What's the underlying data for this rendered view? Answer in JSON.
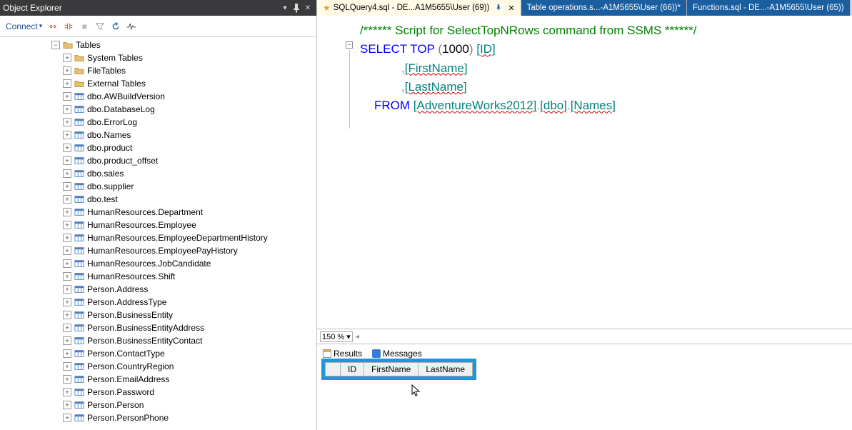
{
  "panel": {
    "title": "Object Explorer",
    "connect_label": "Connect"
  },
  "tree": {
    "root": "Tables",
    "system_tables": "System Tables",
    "file_tables": "FileTables",
    "external_tables": "External Tables",
    "items": [
      "dbo.AWBuildVersion",
      "dbo.DatabaseLog",
      "dbo.ErrorLog",
      "dbo.Names",
      "dbo.product",
      "dbo.product_offset",
      "dbo.sales",
      "dbo.supplier",
      "dbo.test",
      "HumanResources.Department",
      "HumanResources.Employee",
      "HumanResources.EmployeeDepartmentHistory",
      "HumanResources.EmployeePayHistory",
      "HumanResources.JobCandidate",
      "HumanResources.Shift",
      "Person.Address",
      "Person.AddressType",
      "Person.BusinessEntity",
      "Person.BusinessEntityAddress",
      "Person.BusinessEntityContact",
      "Person.ContactType",
      "Person.CountryRegion",
      "Person.EmailAddress",
      "Person.Password",
      "Person.Person",
      "Person.PersonPhone"
    ]
  },
  "tabs": [
    {
      "label": "SQLQuery4.sql - DE...A1M5655\\User (69))",
      "active": true,
      "pinned": true
    },
    {
      "label": "Table operations.s...-A1M5655\\User (66))*",
      "active": false
    },
    {
      "label": "Functions.sql - DE...-A1M5655\\User (65))",
      "active": false
    }
  ],
  "sql": {
    "comment": "/****** Script for SelectTopNRows command from SSMS  ******/",
    "select": "SELECT",
    "top": "TOP",
    "lparen": "(",
    "num": "1000",
    "rparen": ")",
    "col1": "[ID]",
    "col2": "[FirstName]",
    "col3": "[LastName]",
    "from": "FROM",
    "db": "[AdventureWorks2012]",
    "schema": "[dbo]",
    "table": "[Names]",
    "dot": ".",
    "comma": ","
  },
  "zoom": "150 %",
  "result_tabs": {
    "results": "Results",
    "messages": "Messages"
  },
  "result_columns": [
    "ID",
    "FirstName",
    "LastName"
  ]
}
